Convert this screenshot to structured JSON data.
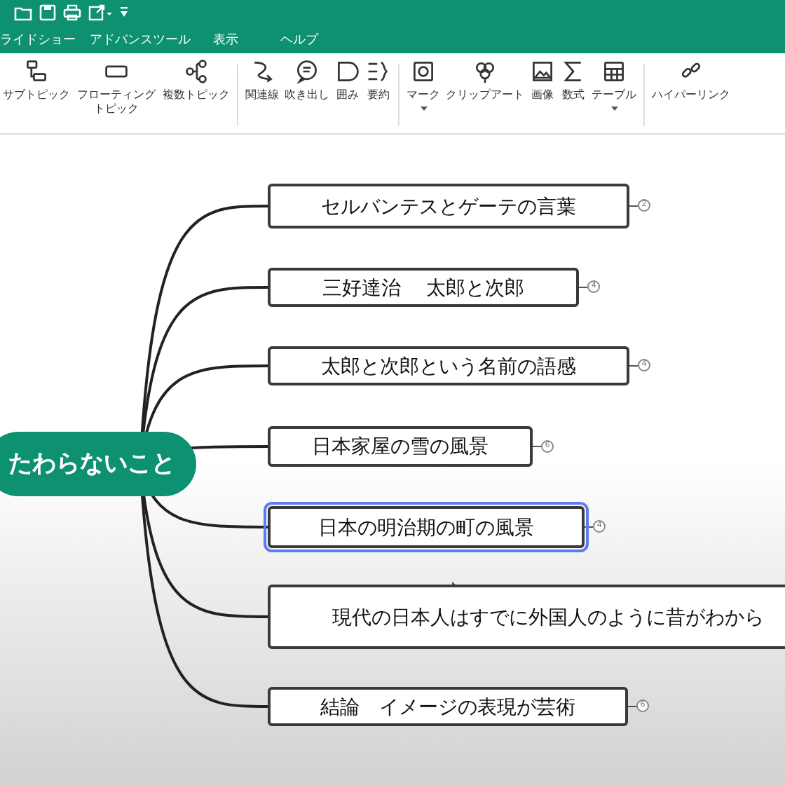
{
  "menu_tabs": [
    {
      "label": "ライドショー"
    },
    {
      "label": "アドバンスツール"
    },
    {
      "label": "表示"
    },
    {
      "label": "ヘルプ"
    }
  ],
  "toolbar": [
    [
      {
        "label": "サブトピック",
        "dropdown": false
      },
      {
        "label": "フローティングトピック",
        "dropdown": false
      },
      {
        "label": "複数トピック",
        "dropdown": false
      }
    ],
    [
      {
        "label": "関連線",
        "dropdown": false
      },
      {
        "label": "吹き出し",
        "dropdown": false
      },
      {
        "label": "囲み",
        "dropdown": false
      },
      {
        "label": "要約",
        "dropdown": false
      }
    ],
    [
      {
        "label": "マーク",
        "dropdown": true
      },
      {
        "label": "クリップアート",
        "dropdown": false
      },
      {
        "label": "画像",
        "dropdown": false
      },
      {
        "label": "数式",
        "dropdown": false
      },
      {
        "label": "テーブル",
        "dropdown": true
      }
    ],
    [
      {
        "label": "ハイパーリンク",
        "dropdown": false
      }
    ]
  ],
  "central_topic": {
    "text": "たわらないこと"
  },
  "topics": [
    {
      "text": "セルバンテスとゲーテの言葉",
      "count": "2",
      "selected": false
    },
    {
      "text": "三好達治　 太郎と次郎",
      "count": "4",
      "selected": false
    },
    {
      "text": "太郎と次郎という名前の語感",
      "count": "4",
      "selected": false
    },
    {
      "text": "日本家屋の雪の風景",
      "count": "6",
      "selected": false
    },
    {
      "text": "日本の明治期の町の風景",
      "count": "4",
      "selected": true
    },
    {
      "text": "現代の日本人はすでに外国人のように昔がわから",
      "selected": false
    },
    {
      "text": "結論　イメージの表現が芸術",
      "count": "6",
      "selected": false
    }
  ]
}
